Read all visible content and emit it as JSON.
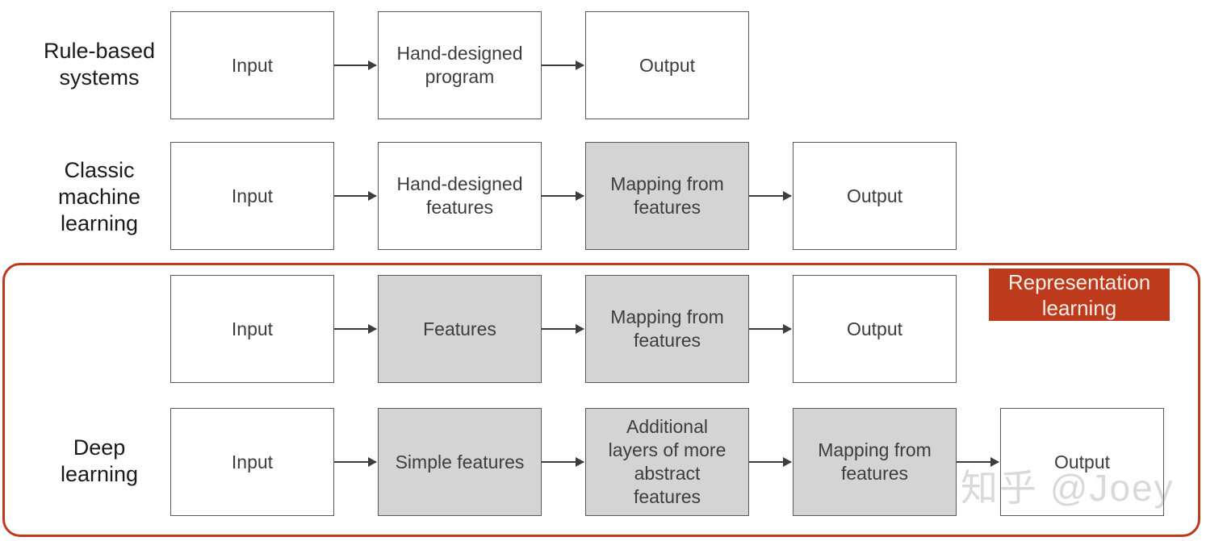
{
  "diagram": {
    "title": "Comparison of AI approaches: rule-based systems, classic machine learning, representation learning and deep learning",
    "colors": {
      "accent_red": "#BE3A1C",
      "shaded_fill": "#D4D4D4",
      "box_stroke": "#595959",
      "text": "#3d3d3d",
      "label_text": "#1a1a1a",
      "badge_text": "#FBEFEA",
      "background": "#ffffff"
    },
    "highlight": {
      "badge_label": "Representation\nlearning"
    },
    "watermark": "知乎 @Joey",
    "rows": [
      {
        "id": "rule-based-systems",
        "label": "Rule-based\nsystems",
        "nodes": [
          {
            "id": "input",
            "text": "Input",
            "shaded": false
          },
          {
            "id": "hand-designed-program",
            "text": "Hand-designed\nprogram",
            "shaded": false
          },
          {
            "id": "output",
            "text": "Output",
            "shaded": false
          }
        ]
      },
      {
        "id": "classic-machine-learning",
        "label": "Classic\nmachine\nlearning",
        "nodes": [
          {
            "id": "input",
            "text": "Input",
            "shaded": false
          },
          {
            "id": "hand-designed-features",
            "text": "Hand-designed\nfeatures",
            "shaded": false
          },
          {
            "id": "mapping-from-features",
            "text": "Mapping from\nfeatures",
            "shaded": true
          },
          {
            "id": "output",
            "text": "Output",
            "shaded": false
          }
        ]
      },
      {
        "id": "representation-learning",
        "label": "",
        "nodes": [
          {
            "id": "input",
            "text": "Input",
            "shaded": false
          },
          {
            "id": "features",
            "text": "Features",
            "shaded": true
          },
          {
            "id": "mapping-from-features",
            "text": "Mapping from\nfeatures",
            "shaded": true
          },
          {
            "id": "output",
            "text": "Output",
            "shaded": false
          }
        ]
      },
      {
        "id": "deep-learning",
        "label": "Deep\nlearning",
        "nodes": [
          {
            "id": "input",
            "text": "Input",
            "shaded": false
          },
          {
            "id": "simple-features",
            "text": "Simple features",
            "shaded": true
          },
          {
            "id": "additional-layers",
            "text": "Additional\nlayers of more\nabstract\nfeatures",
            "shaded": true
          },
          {
            "id": "mapping-from-features",
            "text": "Mapping from\nfeatures",
            "shaded": true
          },
          {
            "id": "output",
            "text": "Output",
            "shaded": false
          }
        ]
      }
    ]
  }
}
